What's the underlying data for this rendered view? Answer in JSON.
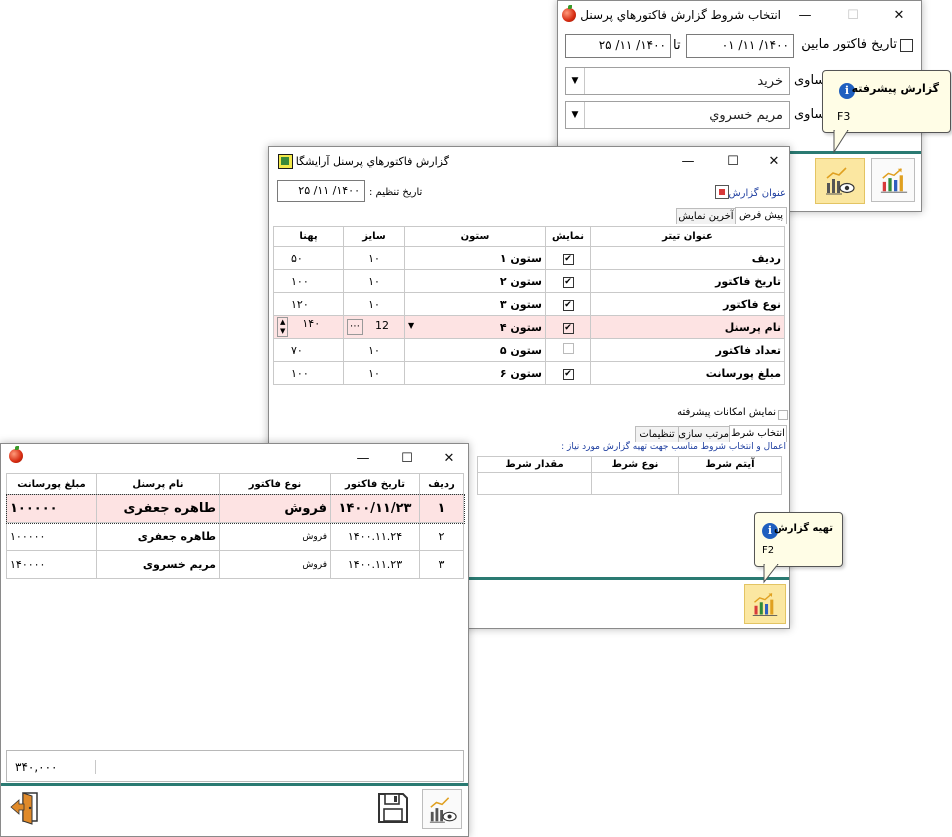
{
  "conditions_window": {
    "title": "انتخاب شروط گزارش فاكتورهاي پرسنل آر...",
    "date_filter": {
      "label": "تاريخ فاكتور مابين",
      "from": "۱۴۰۰/ ۱۱/ ۰۱",
      "connector": "تا",
      "to": "۱۴۰۰/ ۱۱/ ۲۵"
    },
    "row2": {
      "op": "ساوى",
      "value": "خريد"
    },
    "row3": {
      "op": "ساوى",
      "value": "مريم خسروي"
    },
    "tooltip": {
      "title": "گزارش پيشرفته",
      "key": "F3"
    }
  },
  "report_window": {
    "title": "گزارش فاكتورهاي پرسنل آرايشگاه",
    "date_label": "تاريخ تنظيم :",
    "date_value": "۱۴۰۰/ ۱۱/ ۲۵",
    "title_label": "عنوان گزارش :",
    "tabs": [
      "پيش فرض",
      "آخرين نمايش"
    ],
    "columns_header": {
      "heading": "عنوان تيتر",
      "show": "نمايش",
      "column": "ستون",
      "size": "سايز",
      "width": "پهنا"
    },
    "rows": [
      {
        "heading": "رديف",
        "show": true,
        "column": "ستون ۱",
        "size": "۱۰",
        "width": "۵۰"
      },
      {
        "heading": "تاريخ فاكتور",
        "show": true,
        "column": "ستون ۲",
        "size": "۱۰",
        "width": "۱۰۰"
      },
      {
        "heading": "نوع فاكتور",
        "show": true,
        "column": "ستون ۳",
        "size": "۱۰",
        "width": "۱۲۰"
      },
      {
        "heading": "نام پرسنل",
        "show": true,
        "column": "ستون ۴",
        "size": "12",
        "width": "۱۴۰"
      },
      {
        "heading": "تعداد فاكتور",
        "show": false,
        "column": "ستون ۵",
        "size": "۱۰",
        "width": "۷۰"
      },
      {
        "heading": "مبلغ پورسانت",
        "show": true,
        "column": "ستون ۶",
        "size": "۱۰",
        "width": "۱۰۰"
      }
    ],
    "advanced_label": "نمايش امكانات پيشرفته",
    "lower_tabs": [
      "انتخاب شرط",
      "مرتب سازى",
      "تنظيمات"
    ],
    "hint": "اعمال و انتخاب شروط مناسب جهت تهيه گزارش مورد نياز :",
    "cond_headers": {
      "item": "آيتم شرط",
      "type": "نوع شرط",
      "value": "مقدار شرط"
    },
    "tooltip": {
      "title": "تهيه گزارش",
      "key": "F2"
    }
  },
  "result_window": {
    "headers": [
      "رديف",
      "تاريخ فاكتور",
      "نوع فاكتور",
      "نام پرسنل",
      "مبلغ پورسانت"
    ],
    "rows": [
      [
        "۱",
        "۱۴۰۰/۱۱/۲۳",
        "فروش",
        "طاهره جعفرى",
        "۱۰۰۰۰۰"
      ],
      [
        "۲",
        "۱۴۰۰.۱۱.۲۴",
        "فروش",
        "طاهره جعفرى",
        "۱۰۰۰۰۰"
      ],
      [
        "۳",
        "۱۴۰۰.۱۱.۲۳",
        "فروش",
        "مريم خسروى",
        "۱۴۰۰۰۰"
      ]
    ],
    "total": "۳۴۰,۰۰۰"
  }
}
